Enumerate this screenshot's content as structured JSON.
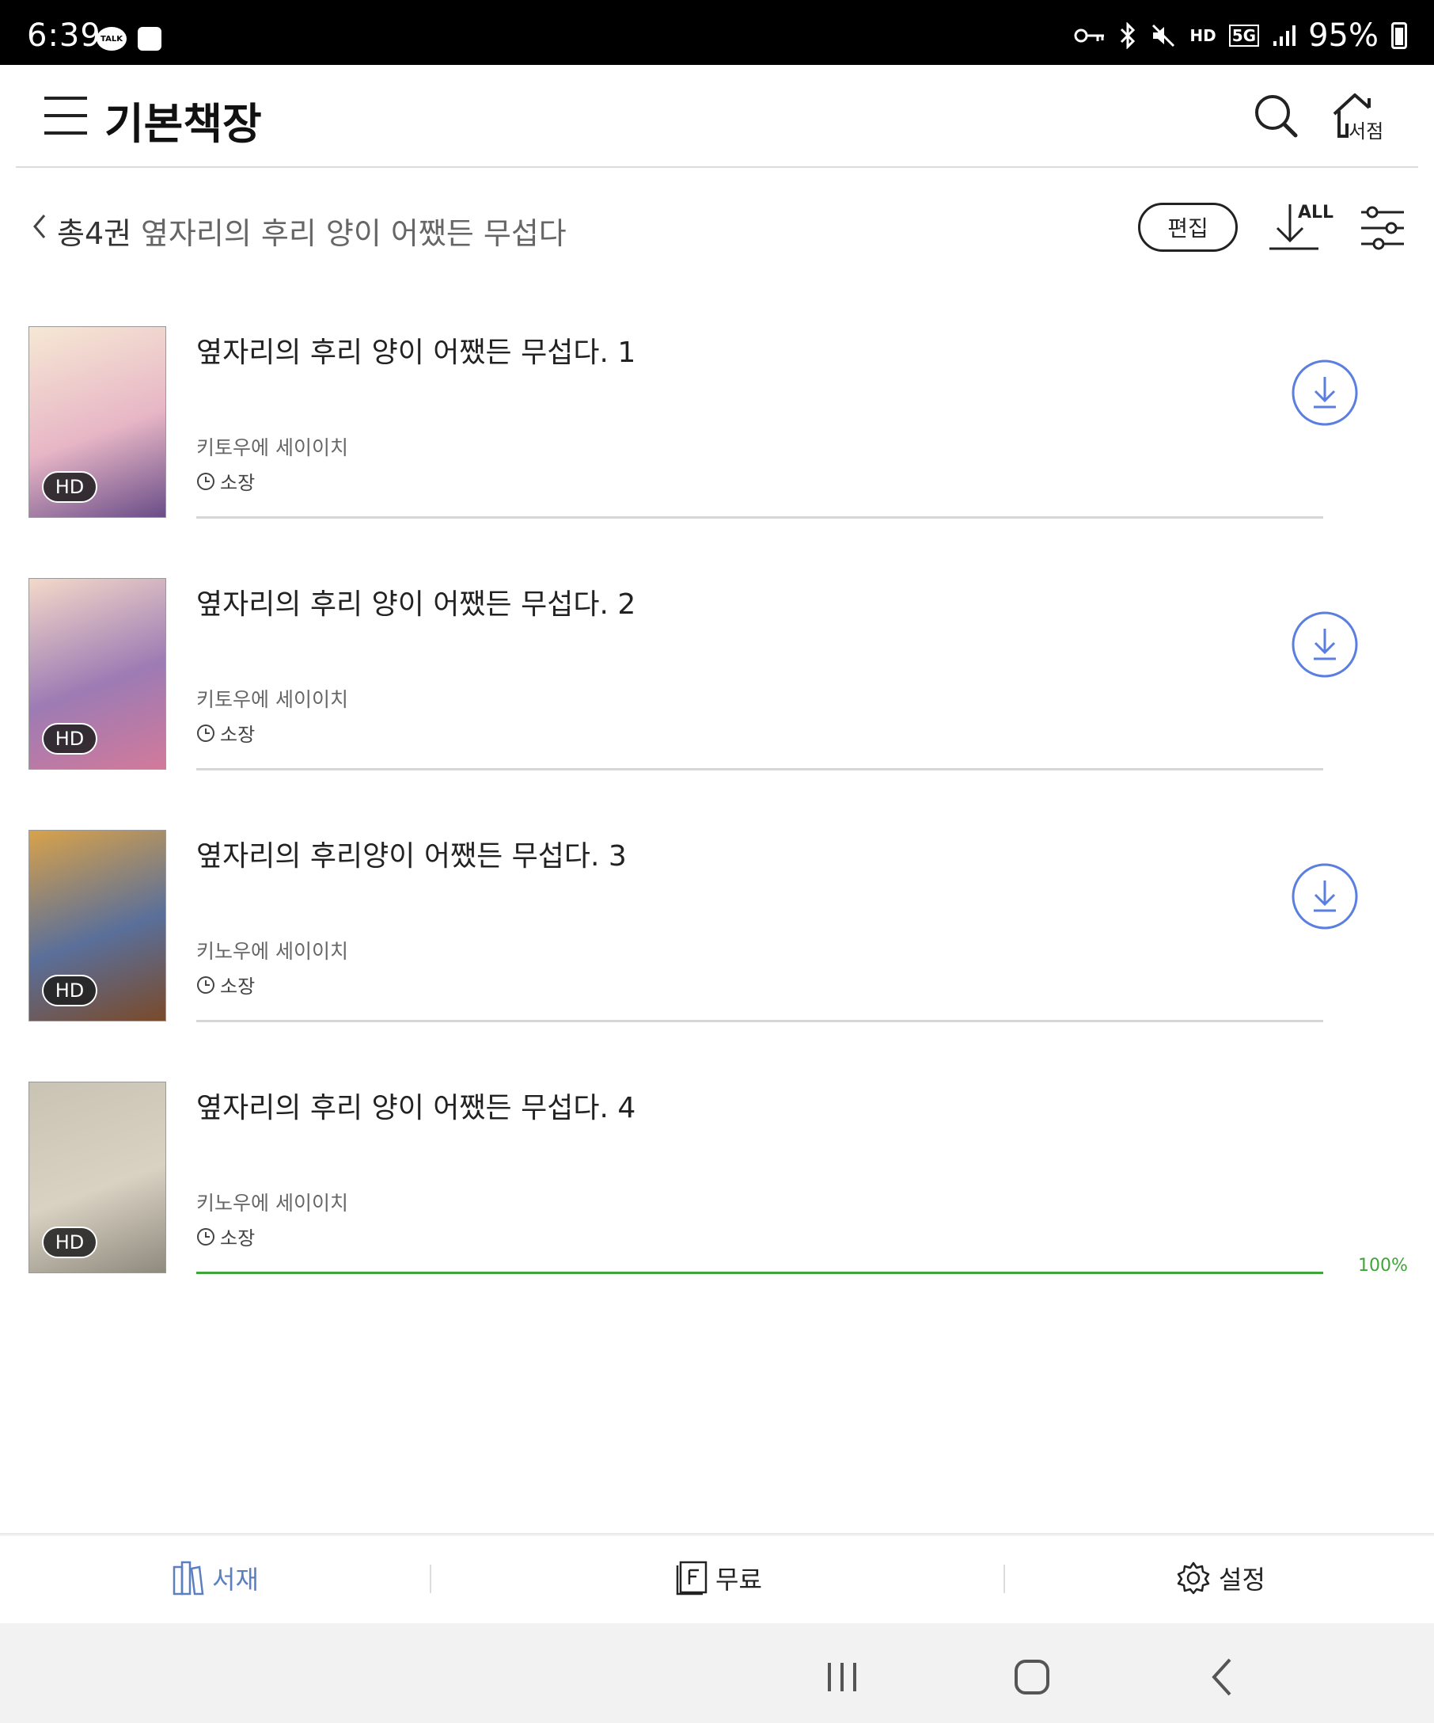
{
  "status_bar": {
    "time": "6:39",
    "talk_label": "TALK",
    "hd_label": "HD",
    "net_label": "5G",
    "battery": "95%"
  },
  "app_bar": {
    "title": "기본책장",
    "store_label": "서점"
  },
  "sub_header": {
    "count": "총4권",
    "series": "옆자리의 후리 양이 어쨌든 무섭다",
    "edit_label": "편집",
    "download_all_label": "ALL"
  },
  "books": [
    {
      "title": "옆자리의 후리 양이 어쨌든 무섭다. 1",
      "author": "키토우에 세이이치",
      "status": "소장",
      "badge": "HD",
      "cover_colors": [
        "#f6e8d4",
        "#e7b6c6",
        "#6a4d88"
      ]
    },
    {
      "title": "옆자리의 후리 양이 어쨌든 무섭다. 2",
      "author": "키토우에 세이이치",
      "status": "소장",
      "badge": "HD",
      "cover_colors": [
        "#f3d9c9",
        "#9d7bb4",
        "#d27a9a"
      ]
    },
    {
      "title": "옆자리의 후리양이 어쨌든 무섭다. 3",
      "author": "키노우에 세이이치",
      "status": "소장",
      "badge": "HD",
      "cover_colors": [
        "#d8a24a",
        "#5a6f9a",
        "#7a4a2a"
      ]
    },
    {
      "title": "옆자리의 후리 양이 어쨌든 무섭다. 4",
      "author": "키노우에 세이이치",
      "status": "소장",
      "badge": "HD",
      "cover_colors": [
        "#c9c3b3",
        "#d9d2c3",
        "#8f8a7e"
      ],
      "progress_pct": 100,
      "progress_label": "100%"
    }
  ],
  "bottom_nav": {
    "items": [
      {
        "label": "서재",
        "icon": "bookshelf-icon",
        "active": true
      },
      {
        "label": "무료",
        "icon": "free-book-icon",
        "active": false
      },
      {
        "label": "설정",
        "icon": "gear-icon",
        "active": false
      }
    ]
  },
  "colors": {
    "accent_blue": "#5b7fe0",
    "progress_green": "#3fa53a",
    "active_nav": "#5b7fbf"
  }
}
